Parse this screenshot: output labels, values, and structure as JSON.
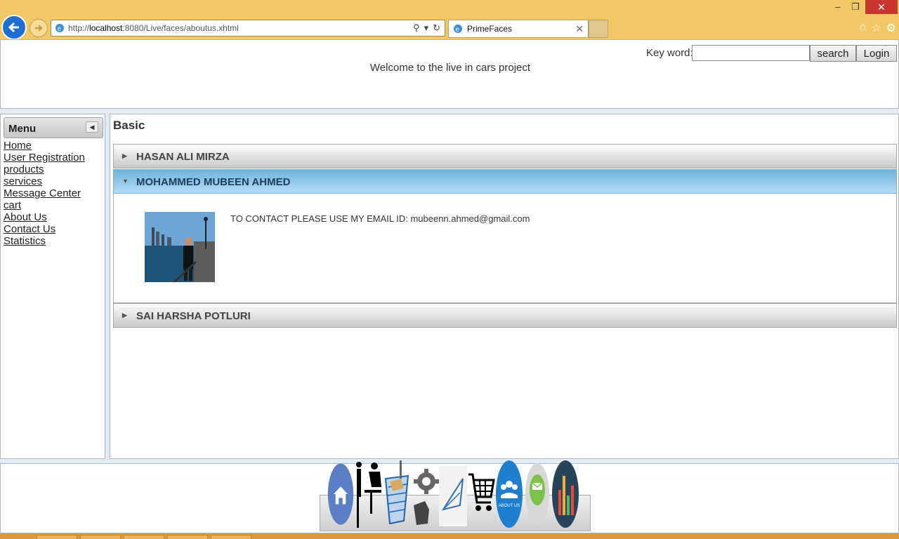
{
  "browser": {
    "url_prefix": "http://",
    "url_host": "localhost",
    "url_rest": ":8080/Live/faces/aboutus.xhtml",
    "tab_title": "PrimeFaces",
    "minimize": "–",
    "restore": "❐",
    "close": "✕"
  },
  "header": {
    "keyword_label": "Key word:",
    "search_label": "search",
    "login_label": "Login",
    "welcome": "Welcome to the live in cars project"
  },
  "sidebar": {
    "title": "Menu",
    "items": [
      {
        "label": "Home"
      },
      {
        "label": "User Registration"
      },
      {
        "label": "products"
      },
      {
        "label": "services"
      },
      {
        "label": "Message Center"
      },
      {
        "label": "cart"
      },
      {
        "label": "About Us"
      },
      {
        "label": "Contact Us"
      },
      {
        "label": "Statistics"
      }
    ]
  },
  "main": {
    "title": "Basic",
    "accordion": [
      {
        "label": "HASAN ALI MIRZA",
        "expanded": false
      },
      {
        "label": "MOHAMMED MUBEEN AHMED",
        "expanded": true,
        "content": "TO CONTACT PLEASE USE MY EMAIL ID: mubeenn.ahmed@gmail.com"
      },
      {
        "label": "SAI HARSHA POTLURI",
        "expanded": false
      }
    ]
  },
  "dock": {
    "icons": [
      "home-icon",
      "user-registration-icon",
      "products-box-icon",
      "services-gear-icon",
      "message-envelope-icon",
      "cart-icon",
      "about-us-icon",
      "contact-us-icon",
      "statistics-icon"
    ],
    "about_us_text": "ABOUT US"
  },
  "colors": {
    "chrome": "#f2c866",
    "active_header": "#6eb3dd",
    "border": "#a8b8c8"
  }
}
